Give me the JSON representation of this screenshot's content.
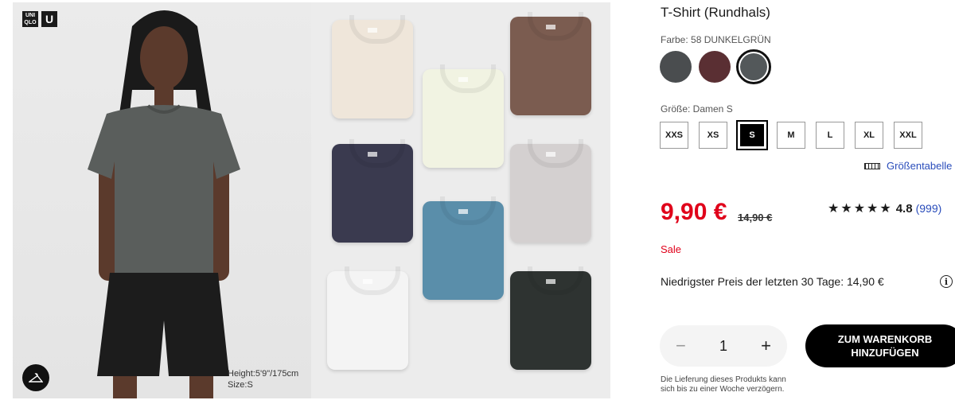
{
  "gallery": {
    "logo": [
      "UNI QLO",
      "U"
    ],
    "model_info": [
      "Height:5'9\"/175cm",
      "Size:S"
    ]
  },
  "shirts": [
    {
      "color": "#efe6da"
    },
    {
      "color": "#f1f3e2"
    },
    {
      "color": "#7b5c50"
    },
    {
      "color": "#3a3a4f"
    },
    {
      "color": "#d4d0d0"
    },
    {
      "color": "#5a8eaa"
    },
    {
      "color": "#f4f4f4"
    },
    {
      "color": "#2e3331"
    }
  ],
  "product": {
    "title": "T-Shirt (Rundhals)",
    "color_label": "Farbe: 58 DUNKELGRÜN",
    "swatches": [
      {
        "name": "charcoal",
        "color": "#4a4d4f"
      },
      {
        "name": "wine",
        "color": "#5a2f33"
      },
      {
        "name": "dark-green",
        "color": "#53585a",
        "selected": true
      }
    ],
    "size_label": "Größe: Damen S",
    "sizes": [
      "XXS",
      "XS",
      "S",
      "M",
      "L",
      "XL",
      "XXL"
    ],
    "selected_size": "S",
    "size_guide": "Größentabelle",
    "price": "9,90 €",
    "old_price": "14,90 €",
    "rating": {
      "stars": "★★★★★",
      "value": "4.8",
      "count": "(999)"
    },
    "sale": "Sale",
    "lowest_price": "Niedrigster Preis der letzten 30 Tage: 14,90 €",
    "quantity": "1",
    "cart_button": [
      "ZUM WARENKORB",
      "HINZUFÜGEN"
    ],
    "delivery_note": "Die Lieferung dieses Produkts kann sich bis zu einer Woche verzögern."
  }
}
